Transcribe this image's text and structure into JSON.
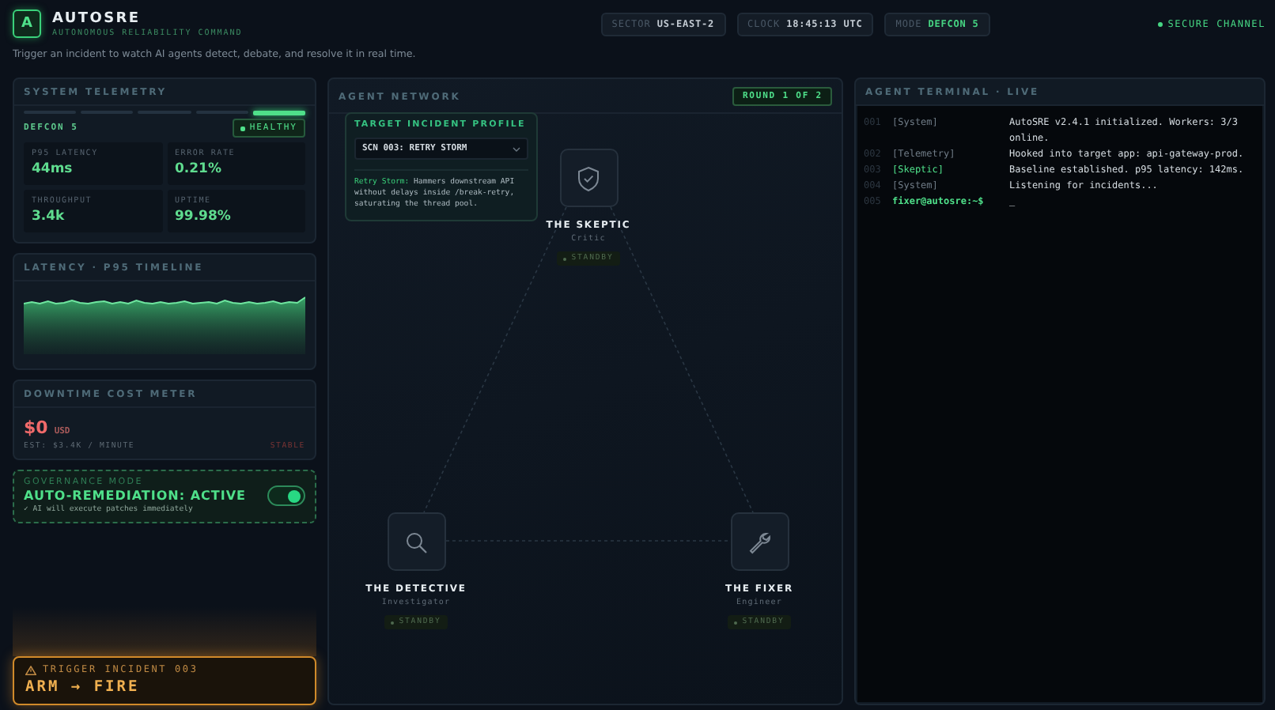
{
  "header": {
    "logo_letter": "A",
    "title": "AUTOSRE",
    "subtitle": "AUTONOMOUS RELIABILITY COMMAND",
    "pills": [
      {
        "label": "SECTOR",
        "value": "US-EAST-2",
        "kind": "plain"
      },
      {
        "label": "CLOCK",
        "value": "18:45:13 UTC",
        "kind": "plain"
      },
      {
        "label": "MODE",
        "value": "DEFCON 5",
        "kind": "accent"
      }
    ],
    "channel": {
      "label": "SECURE CHANNEL",
      "online": true
    }
  },
  "intro": "Trigger an incident to watch AI agents detect, debate, and resolve it in real time.",
  "telemetry": {
    "title": "SYSTEM TELEMETRY",
    "defcon_segments": [
      {
        "on": false
      },
      {
        "on": false
      },
      {
        "on": false
      },
      {
        "on": false
      },
      {
        "on": true
      }
    ],
    "defcon_label": "DEFCON 5",
    "status": "HEALTHY",
    "metrics": [
      {
        "label": "P95 LATENCY",
        "value": "44ms"
      },
      {
        "label": "ERROR RATE",
        "value": "0.21%"
      },
      {
        "label": "THROUGHPUT",
        "value": "3.4k"
      },
      {
        "label": "UPTIME",
        "value": "99.98%"
      }
    ]
  },
  "timeline": {
    "title": "LATENCY · P95 TIMELINE"
  },
  "cost": {
    "title": "DOWNTIME COST METER",
    "amount": "$0",
    "currency": "USD",
    "estimate": "EST: $3.4K / MINUTE",
    "status": "STABLE"
  },
  "governance": {
    "title": "GOVERNANCE MODE",
    "mode": "AUTO-REMEDIATION: ACTIVE",
    "note": "✓ AI will execute patches immediately",
    "on": true
  },
  "trigger": {
    "label": "TRIGGER INCIDENT 003",
    "action": "ARM → FIRE"
  },
  "network": {
    "title": "AGENT NETWORK",
    "round": "ROUND 1 OF 2",
    "profile": {
      "title": "TARGET INCIDENT PROFILE",
      "scenario": "SCN 003: RETRY STORM",
      "description": "**Retry Storm:** Hammers downstream API without delays inside /break-retry, saturating the thread pool."
    },
    "agents": [
      {
        "name": "THE SKEPTIC",
        "role": "Critic",
        "status": "STANDBY",
        "kind": "shield"
      },
      {
        "name": "THE DETECTIVE",
        "role": "Investigator",
        "status": "STANDBY",
        "kind": "search"
      },
      {
        "name": "THE FIXER",
        "role": "Engineer",
        "status": "STANDBY",
        "kind": "wrench"
      }
    ]
  },
  "terminal": {
    "title": "AGENT TERMINAL · LIVE",
    "lines": [
      {
        "kind": "log",
        "number": "001",
        "source": "[System]",
        "message": "AutoSRE v2.4.1 initialized. Workers: 3/3 online.",
        "highlight": false
      },
      {
        "kind": "log",
        "number": "002",
        "source": "[Telemetry]",
        "message": "Hooked into target app: api-gateway-prod.",
        "highlight": false
      },
      {
        "kind": "log",
        "number": "003",
        "source": "[Skeptic]",
        "message": "Baseline established. p95 latency: 142ms.",
        "highlight": true
      },
      {
        "kind": "log",
        "number": "004",
        "source": "[System]",
        "message": "Listening for incidents...",
        "highlight": false
      },
      {
        "kind": "prompt",
        "number": "005",
        "prompt": "fixer@autosre:~$",
        "cursor": "_"
      }
    ]
  }
}
